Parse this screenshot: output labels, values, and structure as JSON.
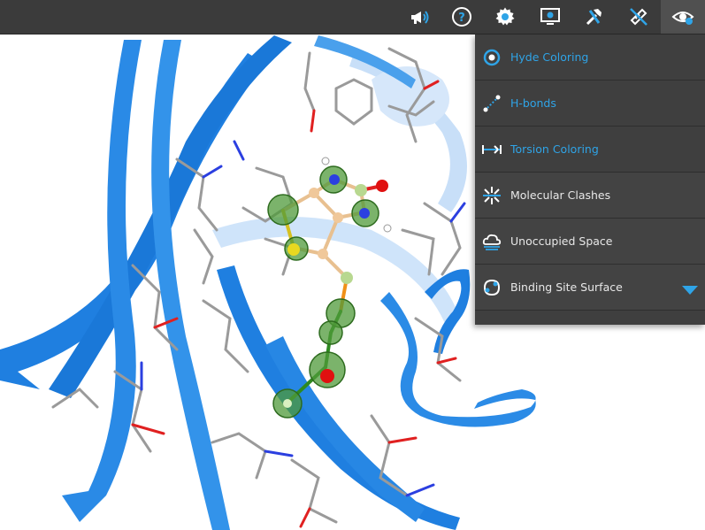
{
  "toolbar": {
    "buttons": [
      {
        "name": "announcements-icon",
        "active": false
      },
      {
        "name": "help-icon",
        "active": false
      },
      {
        "name": "settings-icon",
        "active": false
      },
      {
        "name": "display-icon",
        "active": false
      },
      {
        "name": "tools-icon",
        "active": false
      },
      {
        "name": "measure-icon",
        "active": false
      },
      {
        "name": "visibility-icon",
        "active": true
      }
    ]
  },
  "menu": {
    "items": [
      {
        "label": "Hyde Coloring",
        "icon": "target-icon",
        "active": true
      },
      {
        "label": "H-bonds",
        "icon": "hbond-icon",
        "active": true
      },
      {
        "label": "Torsion Coloring",
        "icon": "torsion-icon",
        "active": true
      },
      {
        "label": "Molecular Clashes",
        "icon": "clash-icon",
        "active": false
      },
      {
        "label": "Unoccupied Space",
        "icon": "cloud-icon",
        "active": false
      },
      {
        "label": "Binding Site Surface",
        "icon": "surface-icon",
        "active": false,
        "expandable": true
      }
    ]
  },
  "colors": {
    "accent": "#2fa4e7",
    "toolbar_bg": "#3b3b3b",
    "menu_bg": "#3f3f3f",
    "ribbon": "#1f7fe0",
    "hyde_green": "#3f8a2e"
  }
}
